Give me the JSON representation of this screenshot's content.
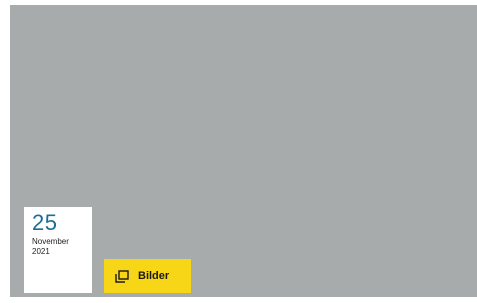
{
  "teaser": {
    "background_color": "#a7abac",
    "date": {
      "day": "25",
      "month": "November",
      "year": "2021"
    },
    "gallery_button": {
      "label": "Bilder",
      "icon": "gallery-copy-icon",
      "color": "#f7d617"
    }
  }
}
